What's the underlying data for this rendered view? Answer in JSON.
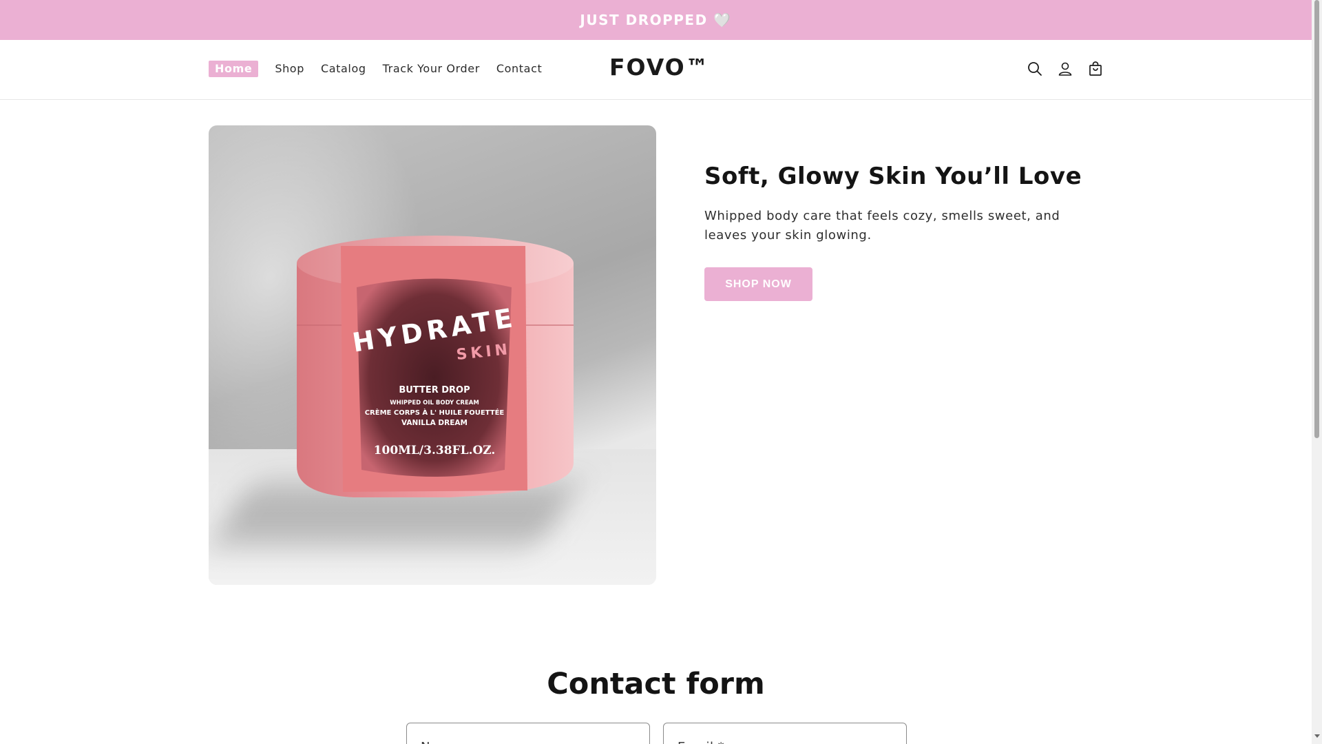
{
  "announcement": {
    "text": "JUST DROPPED 🤍"
  },
  "header": {
    "logo": "FOVO™",
    "nav": [
      {
        "label": "Home",
        "active": true
      },
      {
        "label": "Shop"
      },
      {
        "label": "Catalog"
      },
      {
        "label": "Track Your Order"
      },
      {
        "label": "Contact"
      }
    ],
    "icons": [
      "search-icon",
      "account-icon",
      "cart-icon"
    ]
  },
  "hero": {
    "image": {
      "brand_line1": "HYDRATE",
      "brand_line2": "SKIN",
      "product_name": "BUTTER DROP",
      "desc_line1": "WHIPPED OIL BODY CREAM",
      "desc_line2": "CRÈME CORPS À L' HUILE FOUETTÉE",
      "desc_line3": "VANILLA DREAM",
      "size": "100ML/3.38FL.OZ."
    },
    "title": "Soft, Glowy Skin You’ll Love",
    "subtitle": "Whipped body care that feels cozy, smells sweet, and leaves your skin glowing.",
    "cta": "SHOP NOW"
  },
  "contact": {
    "title": "Contact form",
    "name_placeholder": "Name",
    "email_placeholder": "Email *"
  },
  "colors": {
    "accent": "#ebb0d3",
    "jar": "#e8868a",
    "label": "#6b2f36"
  }
}
